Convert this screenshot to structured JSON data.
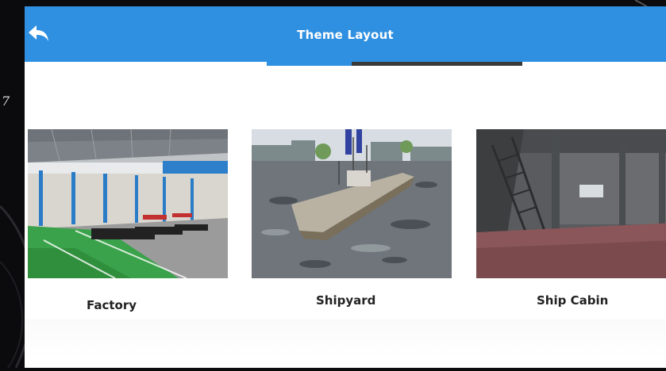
{
  "header": {
    "title": "Theme Layout",
    "back_icon": "back-arrow-icon"
  },
  "tabs": {
    "active_index": 0,
    "count": 3
  },
  "themes": [
    {
      "label": "Factory"
    },
    {
      "label": "Shipyard"
    },
    {
      "label": "Ship Cabin"
    }
  ],
  "colors": {
    "accent": "#2f8fe0",
    "tab_track": "#3a3a3a"
  },
  "edge_glyph": "7"
}
